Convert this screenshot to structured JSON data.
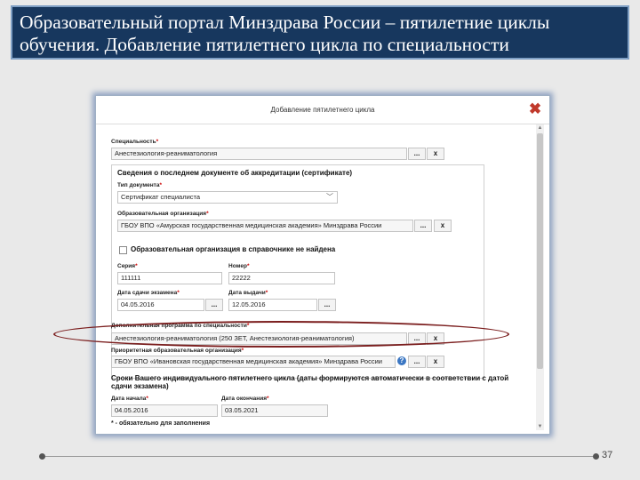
{
  "slide": {
    "title_line1": "Образовательный портал Минздрава России – пятилетние циклы",
    "title_line2": "обучения. Добавление пятилетнего цикла по специальности",
    "page_number": "37"
  },
  "dialog": {
    "title": "Добавление пятилетнего цикла",
    "close_glyph": "✖",
    "specialty": {
      "label": "Специальность",
      "value": "Анестезиология-реаниматология",
      "btn_more": "...",
      "btn_clear": "x"
    },
    "accreditation": {
      "title": "Сведения о последнем документе об аккредитации (сертификате)",
      "doc_type": {
        "label": "Тип документа",
        "value": "Сертификат специалиста",
        "caret": "﹀"
      },
      "org": {
        "label": "Образовательная организация",
        "value": "ГБОУ ВПО «Амурская государственная медицинская академия» Минздрава России",
        "btn_more": "...",
        "btn_clear": "x"
      },
      "org_not_found": "Образовательная организация в справочнике не найдена",
      "series": {
        "label": "Серия",
        "value": "111111"
      },
      "number": {
        "label": "Номер",
        "value": "22222"
      },
      "exam_date": {
        "label": "Дата сдачи экзамена",
        "value": "04.05.2016",
        "btn_more": "..."
      },
      "issue_date": {
        "label": "Дата выдачи",
        "value": "12.05.2016",
        "btn_more": "..."
      }
    },
    "program": {
      "label": "Дополнительная программа по специальности",
      "value": "Анестезиология-реаниматология (250 ЗЕТ, Анестезиология-реаниматология)",
      "btn_more": "...",
      "btn_clear": "x"
    },
    "priority_org": {
      "label": "Приоритетная образовательная организация",
      "value": "ГБОУ ВПО «Ивановская государственная медицинская академия» Минздрава России",
      "info": "?",
      "btn_more": "...",
      "btn_clear": "x"
    },
    "cycle_terms": {
      "title_line1": "Сроки Вашего индивидуального пятилетнего цикла (даты формируются автоматически в соответствии с датой",
      "title_line2": "сдачи экзамена)",
      "start": {
        "label": "Дата начала",
        "value": "04.05.2016"
      },
      "end": {
        "label": "Дата окончания",
        "value": "03.05.2021"
      }
    },
    "required_note": "* - обязательно для заполнения",
    "required_mark": "*"
  },
  "colors": {
    "title_bg": "#17375e",
    "highlight": "#7b1e1e",
    "dialog_glow": "#8fa2c2",
    "close": "#c0392b"
  }
}
